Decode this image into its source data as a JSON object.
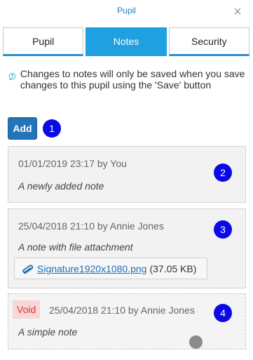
{
  "header": {
    "title": "Pupil",
    "close_glyph": "×"
  },
  "tabs": [
    {
      "label": "Pupil",
      "active": false
    },
    {
      "label": "Notes",
      "active": true
    },
    {
      "label": "Security",
      "active": false
    }
  ],
  "info": {
    "icon": "question-bubble-icon",
    "text": "Changes to notes will only be saved when you save changes to this pupil using the 'Save' button"
  },
  "add_button": {
    "label": "Add",
    "badge": "1"
  },
  "notes": [
    {
      "meta": "01/01/2019 23:17 by You",
      "text": "A newly added note",
      "badge": "2"
    },
    {
      "meta": "25/04/2018 21:10 by Annie Jones",
      "text": "A note with file attachment",
      "badge": "3",
      "attachment": {
        "name": "Signature1920x1080.png",
        "size": "(37.05 KB)",
        "icon": "paperclip-icon"
      }
    },
    {
      "void_label": "Void",
      "meta": "25/04/2018 21:10 by Annie Jones",
      "text": "A simple note",
      "badge": "4"
    }
  ],
  "colors": {
    "accent": "#1fa0e0",
    "add_button": "#2474b8",
    "badge": "#0a0ae6",
    "void_bg": "#f7d7d7",
    "void_text": "#dd3333",
    "link": "#1f6fb5"
  }
}
